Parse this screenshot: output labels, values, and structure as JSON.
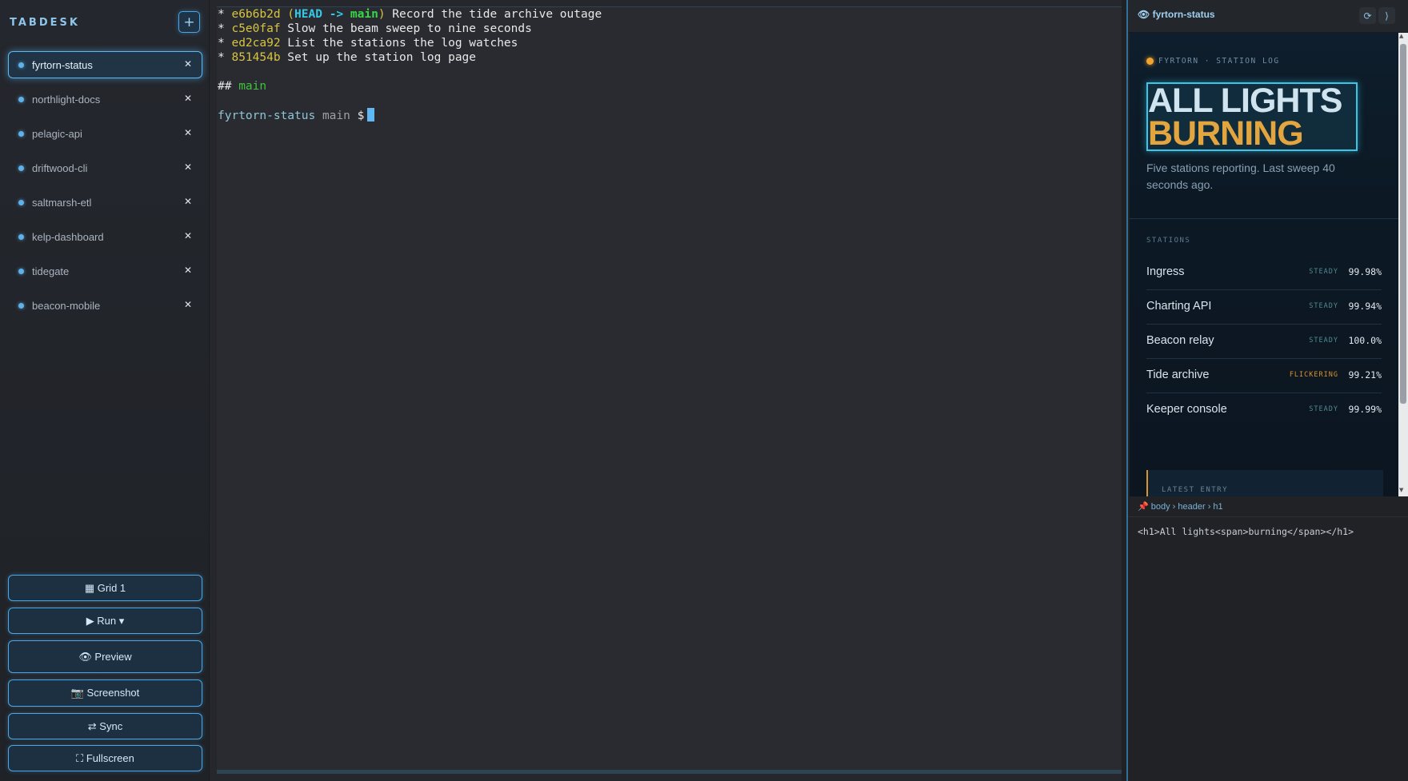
{
  "sidebar": {
    "brand": "TABDESK",
    "add_label": "+",
    "tabs": [
      {
        "label": "fyrtorn-status",
        "active": true
      },
      {
        "label": "northlight-docs"
      },
      {
        "label": "pelagic-api"
      },
      {
        "label": "driftwood-cli"
      },
      {
        "label": "saltmarsh-etl"
      },
      {
        "label": "kelp-dashboard"
      },
      {
        "label": "tidegate"
      },
      {
        "label": "beacon-mobile"
      }
    ],
    "close_glyph": "✕",
    "buttons": {
      "grid": "▦ Grid 1",
      "run": "▶ Run ▾",
      "preview": "👁 Preview",
      "screenshot": "📷 Screenshot",
      "sync": "⇄ Sync",
      "fullscreen": "⛶ Fullscreen"
    }
  },
  "terminal": {
    "log": [
      {
        "hash": "e6b6b2d",
        "ref_open": " (",
        "ref_head": "HEAD -> ",
        "ref_branch": "main",
        "ref_close": ")",
        "msg": " Record the tide archive outage"
      },
      {
        "hash": "c5e0faf",
        "msg": " Slow the beam sweep to nine seconds"
      },
      {
        "hash": "ed2ca92",
        "msg": " List the stations the log watches"
      },
      {
        "hash": "851454b",
        "msg": " Set up the station log page"
      }
    ],
    "bullet": "* ",
    "status_prefix": "## ",
    "status_branch": "main",
    "prompt_name": "fyrtorn-status",
    "prompt_branch": " main ",
    "prompt_symbol": "$"
  },
  "preview": {
    "title": "👁 fyrtorn-status",
    "refresh_icon": "⟳",
    "collapse_icon": "⟩",
    "site": {
      "eyebrow": "FYRTORN · STATION LOG",
      "hero_line1": "All lights",
      "hero_line2": "burning",
      "lede": "Five stations reporting. Last sweep 40 seconds ago.",
      "section_label": "STATIONS",
      "stations": [
        {
          "name": "Ingress",
          "status": "STEADY",
          "value": "99.98%"
        },
        {
          "name": "Charting API",
          "status": "STEADY",
          "value": "99.94%"
        },
        {
          "name": "Beacon relay",
          "status": "STEADY",
          "value": "100.0%"
        },
        {
          "name": "Tide archive",
          "status": "FLICKERING",
          "value": "99.21%"
        },
        {
          "name": "Keeper console",
          "status": "STEADY",
          "value": "99.99%"
        }
      ],
      "latest_label": "LATEST ENTRY"
    },
    "breadcrumb": {
      "pin": "📌",
      "path": "body › header › h1"
    },
    "source": "<h1>All lights<span>burning</span></h1>",
    "colors": {
      "accent": "#3bc6e8",
      "amber": "#e3a53f",
      "warn": "#d9942d"
    }
  }
}
